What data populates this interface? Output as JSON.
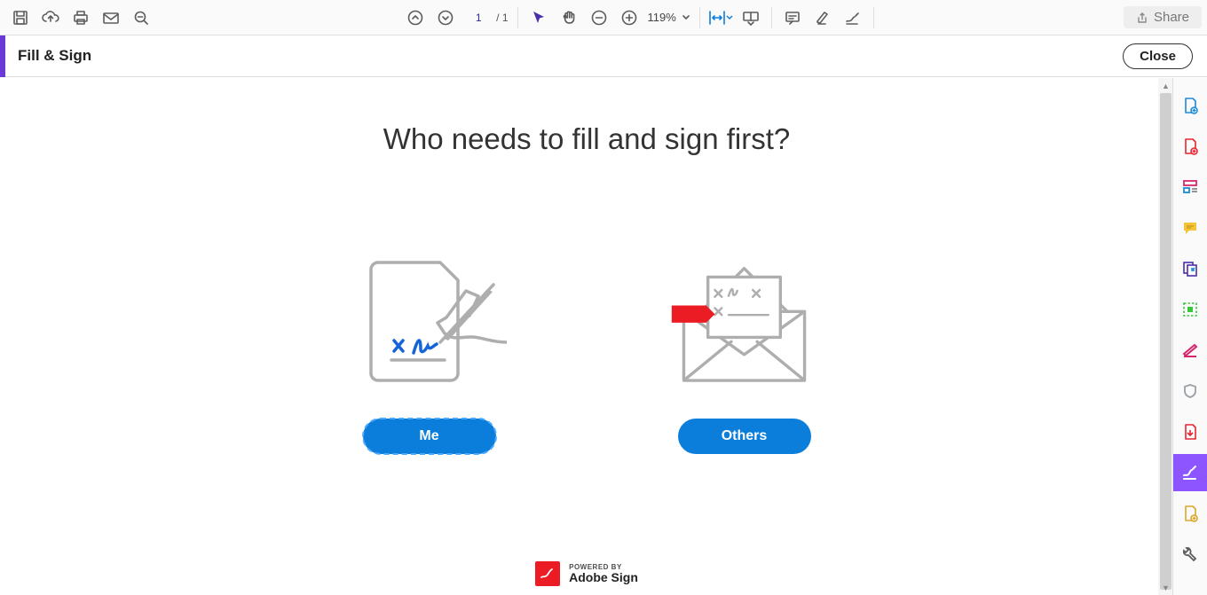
{
  "toolbar": {
    "page_current": "1",
    "page_total": "/ 1",
    "zoom": "119%",
    "share": "Share"
  },
  "secondary": {
    "title": "Fill & Sign",
    "close": "Close"
  },
  "main": {
    "headline": "Who needs to fill and sign first?",
    "me": "Me",
    "others": "Others"
  },
  "footer": {
    "small": "POWERED BY",
    "big": "Adobe Sign"
  }
}
